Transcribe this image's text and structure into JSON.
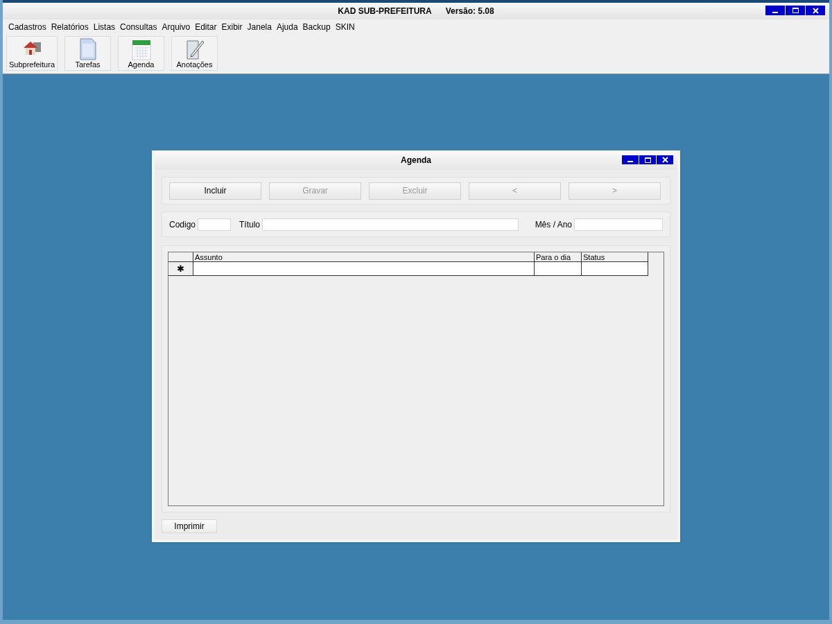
{
  "window": {
    "title": "KAD SUB-PREFEITURA",
    "version": "Versão: 5.08"
  },
  "menu": [
    "Cadastros",
    "Relatórios",
    "Listas",
    "Consultas",
    "Arquivo",
    "Editar",
    "Exibir",
    "Janela",
    "Ajuda",
    "Backup",
    "SKIN"
  ],
  "toolbar": [
    {
      "label": "Subprefeitura",
      "kind": "house"
    },
    {
      "label": "Tarefas",
      "kind": "document"
    },
    {
      "label": "Agenda",
      "kind": "calendar"
    },
    {
      "label": "Anotações",
      "kind": "notepad"
    }
  ],
  "agenda": {
    "title": "Agenda",
    "buttons": [
      {
        "label": "Incluir",
        "disabled": false
      },
      {
        "label": "Gravar",
        "disabled": true
      },
      {
        "label": "Excluir",
        "disabled": true
      },
      {
        "label": "<",
        "disabled": true
      },
      {
        "label": ">",
        "disabled": true
      }
    ],
    "fields": [
      {
        "label": "Codigo"
      },
      {
        "label": "Título"
      },
      {
        "label": "Mês / Ano"
      }
    ],
    "table": {
      "columns": [
        "Assunto",
        "Para o dia",
        "Status"
      ],
      "new_row_marker": "✱"
    },
    "print_button": "Imprimir"
  }
}
